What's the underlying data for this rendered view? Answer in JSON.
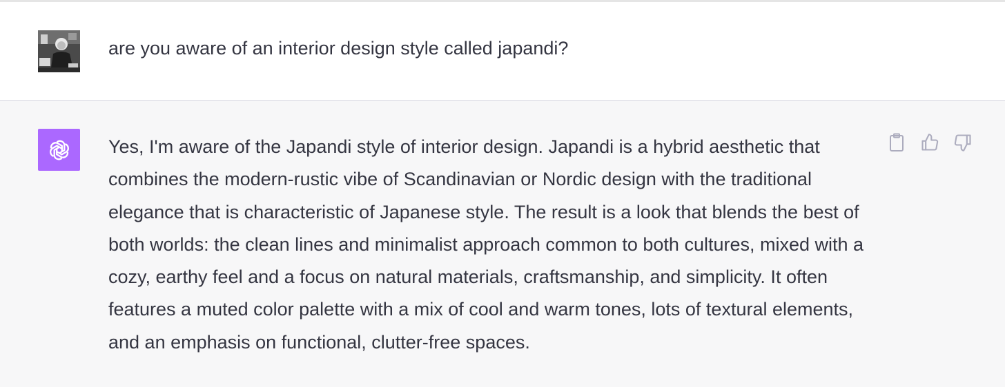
{
  "user_message": {
    "text": "are you aware of an interior design style called japandi?",
    "avatar_icon": "user-photo-avatar"
  },
  "assistant_message": {
    "avatar_icon": "openai-logo-icon",
    "avatar_color": "#ab68ff",
    "lines": [
      "Yes, I'm aware of the Japandi style of interior design. Japandi is a hybrid aesthetic that",
      "combines the modern-rustic vibe of Scandinavian or Nordic design with the traditional",
      "elegance that is characteristic of Japanese style. The result is a look that blends the best of",
      "both worlds: the clean lines and minimalist approach common to both cultures, mixed with a",
      "cozy, earthy feel and a focus on natural materials, craftsmanship, and simplicity. It often",
      "features a muted color palette with a mix of cool and warm tones, lots of textural elements,",
      "and an emphasis on functional, clutter-free spaces."
    ],
    "actions": [
      "clipboard-icon",
      "thumbs-up-icon",
      "thumbs-down-icon"
    ]
  },
  "colors": {
    "text": "#343541",
    "assistant_bg": "#f7f7f8",
    "icon": "#acacbe"
  }
}
